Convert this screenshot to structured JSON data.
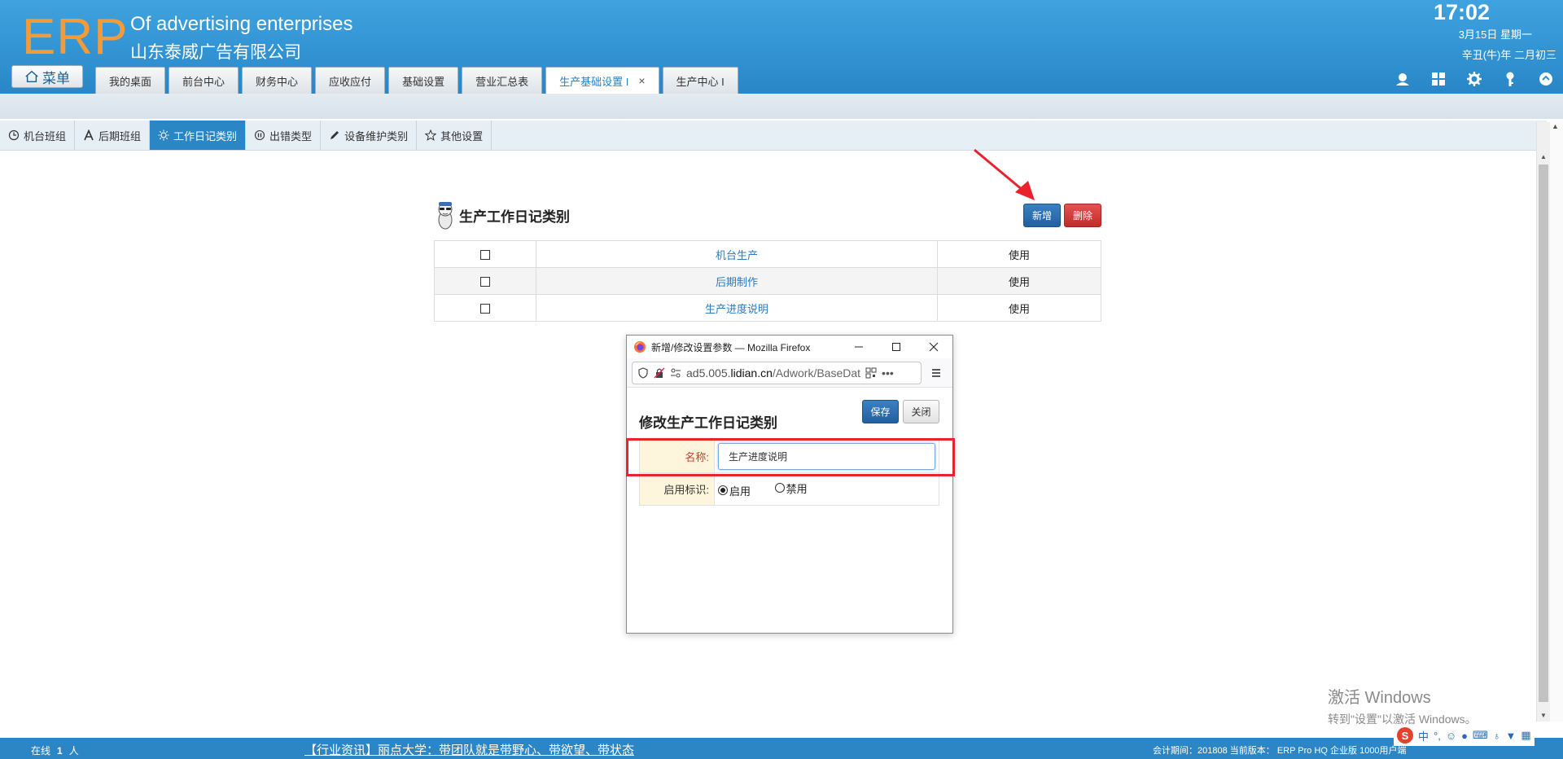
{
  "header": {
    "logo": "ERP",
    "company_en": "Of advertising enterprises",
    "company_cn": "山东泰威广告有限公司",
    "menu_label": "菜单",
    "time": "17:02",
    "date": "3月15日 星期一",
    "lunar_date": "辛丑(牛)年 二月初三",
    "tabs": [
      {
        "label": "我的桌面"
      },
      {
        "label": "前台中心"
      },
      {
        "label": "财务中心"
      },
      {
        "label": "应收应付"
      },
      {
        "label": "基础设置"
      },
      {
        "label": "营业汇总表"
      },
      {
        "label": "生产基础设置 I",
        "close": "×"
      },
      {
        "label": "生产中心 I"
      }
    ],
    "icons": [
      "user-icon",
      "dashboard-icon",
      "gear-icon",
      "key-icon",
      "collapse-up-icon"
    ]
  },
  "subtabs": [
    {
      "label": "机台班组",
      "icon": "clock-icon"
    },
    {
      "label": "后期班组",
      "icon": "text-a-icon"
    },
    {
      "label": "工作日记类别",
      "icon": "sun-icon"
    },
    {
      "label": "出错类型",
      "icon": "pause-icon"
    },
    {
      "label": "设备维护类别",
      "icon": "pencil-icon"
    },
    {
      "label": "其他设置",
      "icon": "star-icon"
    }
  ],
  "main": {
    "title": "生产工作日记类别",
    "add_label": "新增",
    "delete_label": "删除",
    "rows": [
      {
        "name": "机台生产",
        "status": "使用"
      },
      {
        "name": "后期制作",
        "status": "使用"
      },
      {
        "name": "生产进度说明",
        "status": "使用"
      }
    ]
  },
  "popup": {
    "window_title": "新增/修改设置参数 — Mozilla Firefox",
    "url_domain_prefix": "ad5.005.",
    "url_domain": "lidian.cn",
    "url_path": "/Adwork/BaseDat",
    "url_more": "•••",
    "heading": "修改生产工作日记类别",
    "save_label": "保存",
    "close_label": "关闭",
    "name_label": "名称:",
    "name_value": "生产进度说明",
    "enabled_label": "启用标识:",
    "radio_enabled": "启用",
    "radio_disabled": "禁用",
    "enabled_selected": true
  },
  "watermark": {
    "line1": "激活 Windows",
    "line2": "转到\"设置\"以激活 Windows。"
  },
  "footer": {
    "online_label": "在线",
    "online_count": "1",
    "online_unit": "人",
    "news": "【行业资讯】丽点大学：带团队就是带野心、带欲望、带状态",
    "meta": "会计期间：201808 当前版本： ERP Pro HQ 企业版 1000用户端"
  },
  "tray": {
    "ime_mode": "中",
    "items": [
      "punctuation-icon",
      "emoji-icon",
      "mic-icon",
      "keyboard-icon",
      "skin-icon",
      "shirt-icon",
      "grid-icon"
    ]
  },
  "colors": {
    "header_blue": "#2f8fcf",
    "accent_blue": "#2b86c6",
    "logo_orange": "#f29b3a",
    "delete_red": "#c22a27",
    "highlight_red": "#e8232b"
  }
}
